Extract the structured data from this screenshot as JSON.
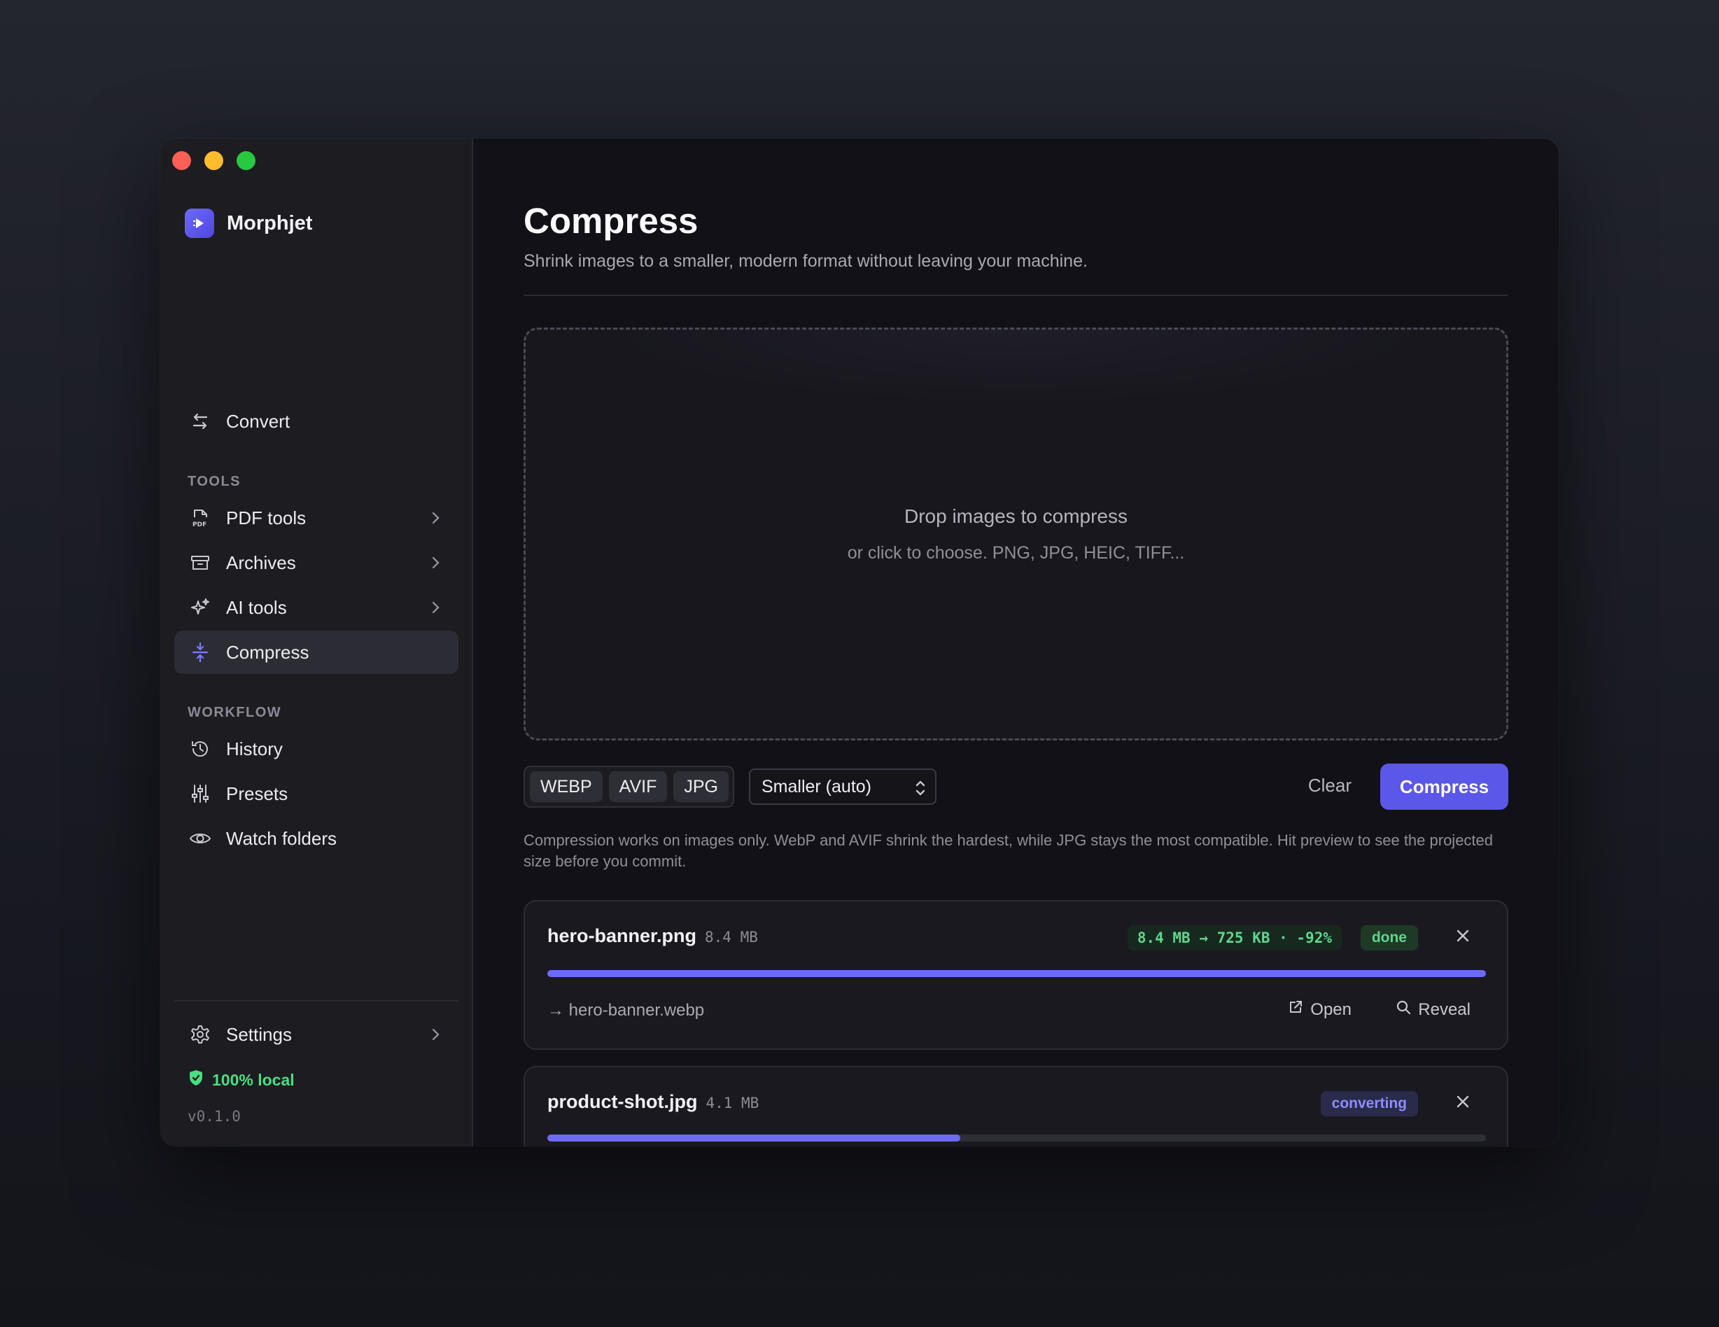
{
  "app": {
    "name": "Morphjet",
    "version": "v0.1.0",
    "local_badge": "100% local"
  },
  "sidebar": {
    "top_items": [
      {
        "label": "Convert",
        "icon": "arrows-swap-icon"
      }
    ],
    "sections": [
      {
        "label": "TOOLS",
        "items": [
          {
            "label": "PDF tools",
            "icon": "pdf-file-icon",
            "chevron": true
          },
          {
            "label": "Archives",
            "icon": "archive-box-icon",
            "chevron": true
          },
          {
            "label": "AI tools",
            "icon": "sparkle-icon",
            "chevron": true
          },
          {
            "label": "Compress",
            "icon": "compress-icon",
            "active": true
          }
        ]
      },
      {
        "label": "WORKFLOW",
        "items": [
          {
            "label": "History",
            "icon": "history-icon"
          },
          {
            "label": "Presets",
            "icon": "sliders-icon"
          },
          {
            "label": "Watch folders",
            "icon": "eye-icon"
          }
        ]
      }
    ],
    "settings_label": "Settings"
  },
  "main": {
    "title": "Compress",
    "subtitle": "Shrink images to a smaller, modern format without leaving your machine.",
    "dropzone": {
      "title": "Drop images to compress",
      "subtitle": "or click to choose. PNG, JPG, HEIC, TIFF..."
    },
    "formats": [
      "WEBP",
      "AVIF",
      "JPG"
    ],
    "quality_select": "Smaller (auto)",
    "clear_label": "Clear",
    "compress_label": "Compress",
    "help_text": "Compression works on images only. WebP and AVIF shrink the hardest, while JPG stays the most compatible. Hit preview to see the projected size before you commit.",
    "files": [
      {
        "name": "hero-banner.png",
        "size": "8.4 MB",
        "stat": "8.4 MB → 725 KB · -92%",
        "status": "done",
        "progress": 1.0,
        "output": "→ hero-banner.webp",
        "open_label": "Open",
        "reveal_label": "Reveal"
      },
      {
        "name": "product-shot.jpg",
        "size": "4.1 MB",
        "status": "converting",
        "progress": 0.44
      }
    ]
  },
  "colors": {
    "accent": "#5b57e8",
    "success": "#5ed68c",
    "sidebar_bg": "#1c1c21",
    "main_bg": "#121117"
  }
}
